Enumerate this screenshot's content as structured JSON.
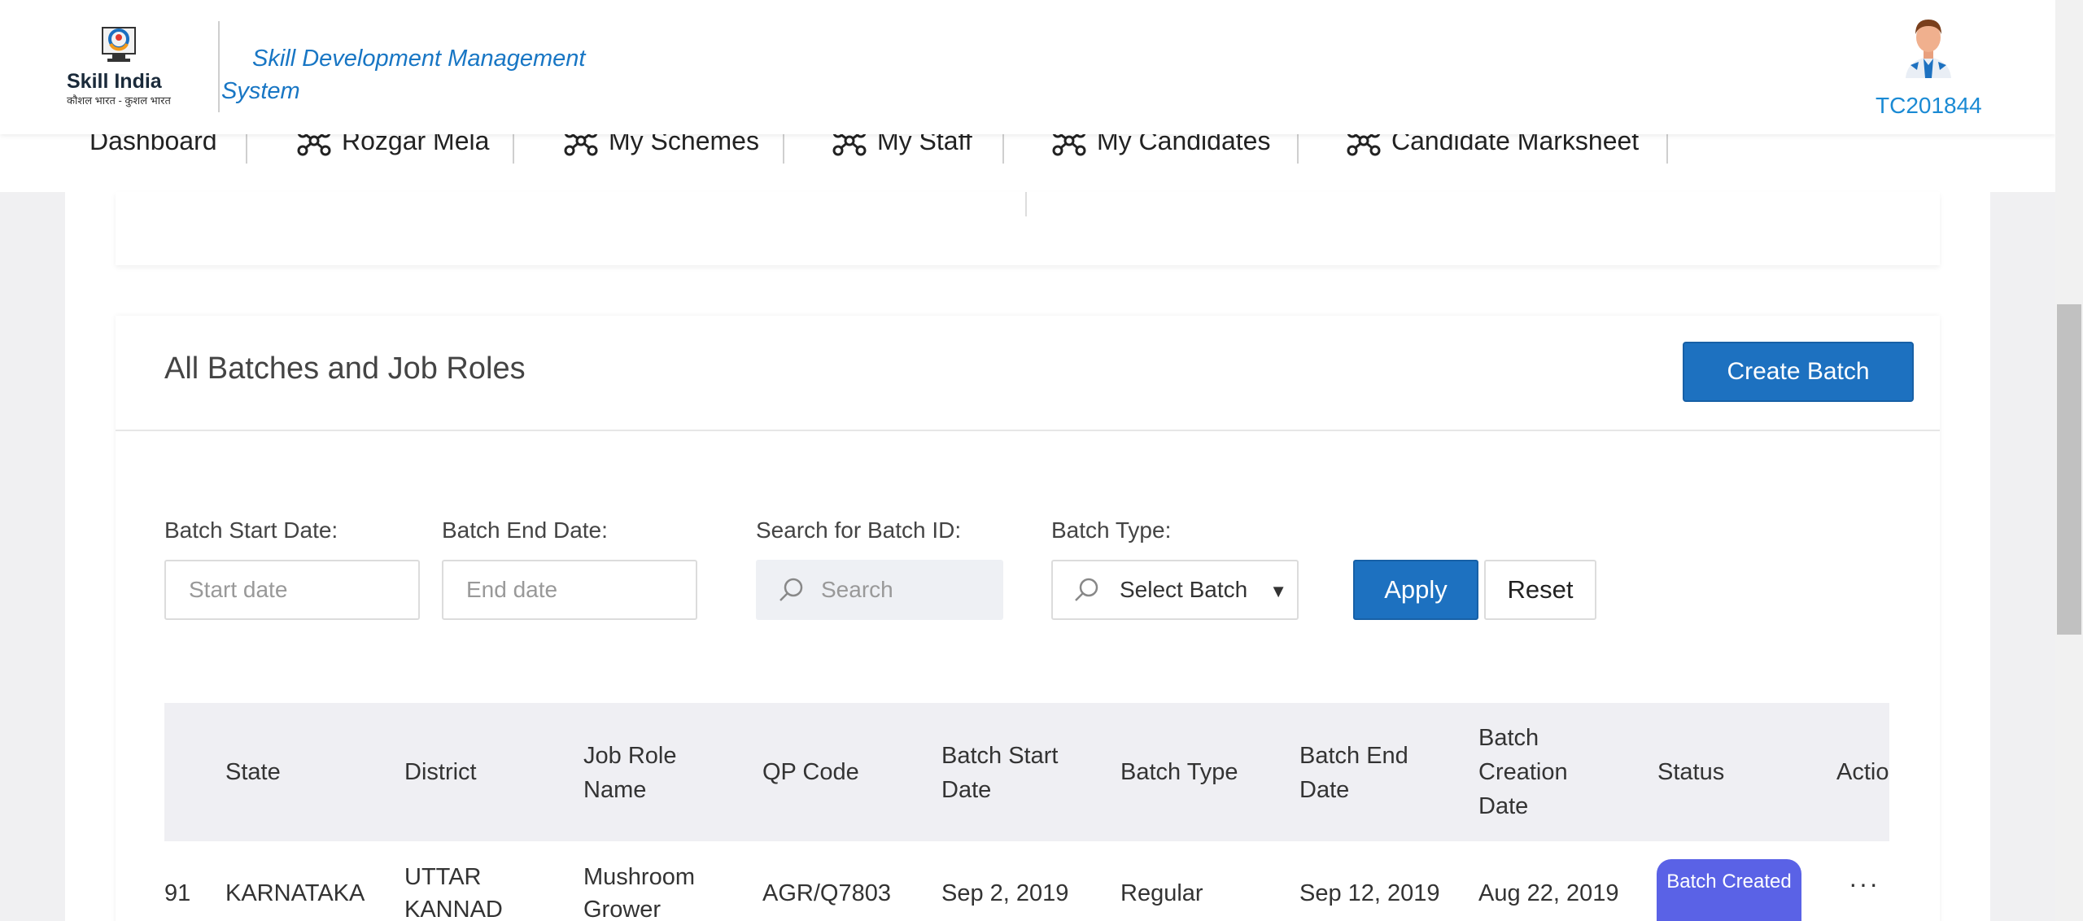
{
  "header": {
    "brand": "Skill India",
    "tagline": "कौशल भारत - कुशल भारत",
    "app_title": "Skill Development Management System",
    "user_id": "TC201844"
  },
  "nav": {
    "items": [
      {
        "label": "Dashboard"
      },
      {
        "label": "Rozgar Mela"
      },
      {
        "label": "My Schemes"
      },
      {
        "label": "My Staff"
      },
      {
        "label": "My Candidates"
      },
      {
        "label": "Candidate Marksheet"
      }
    ]
  },
  "batches": {
    "title": "All Batches and Job Roles",
    "create_label": "Create Batch",
    "filters": {
      "start_label": "Batch Start Date:",
      "start_placeholder": "Start date",
      "end_label": "Batch End Date:",
      "end_placeholder": "End date",
      "search_label": "Search for Batch ID:",
      "search_placeholder": "Search",
      "type_label": "Batch Type:",
      "type_value": "Select Batch",
      "apply_label": "Apply",
      "reset_label": "Reset"
    },
    "table": {
      "headers": {
        "state": "State",
        "district": "District",
        "job_role": "Job Role Name",
        "qp_code": "QP Code",
        "start": "Batch Start Date",
        "type": "Batch Type",
        "end": "Batch End Date",
        "created": "Batch Creation Date",
        "status": "Status",
        "action": "Actio"
      },
      "rows": [
        {
          "id_tail": "91",
          "state": "KARNATAKA",
          "district": "UTTAR KANNAD",
          "job_role": "Mushroom Grower",
          "qp_code": "AGR/Q7803",
          "start": "Sep 2, 2019",
          "type": "Regular",
          "end": "Sep 12, 2019",
          "created": "Aug 22, 2019",
          "status": "Batch Created",
          "action": "···"
        }
      ]
    }
  },
  "colors": {
    "primary": "#1d71c0",
    "title_blue": "#1876c4",
    "status_badge": "#5a62e6"
  }
}
